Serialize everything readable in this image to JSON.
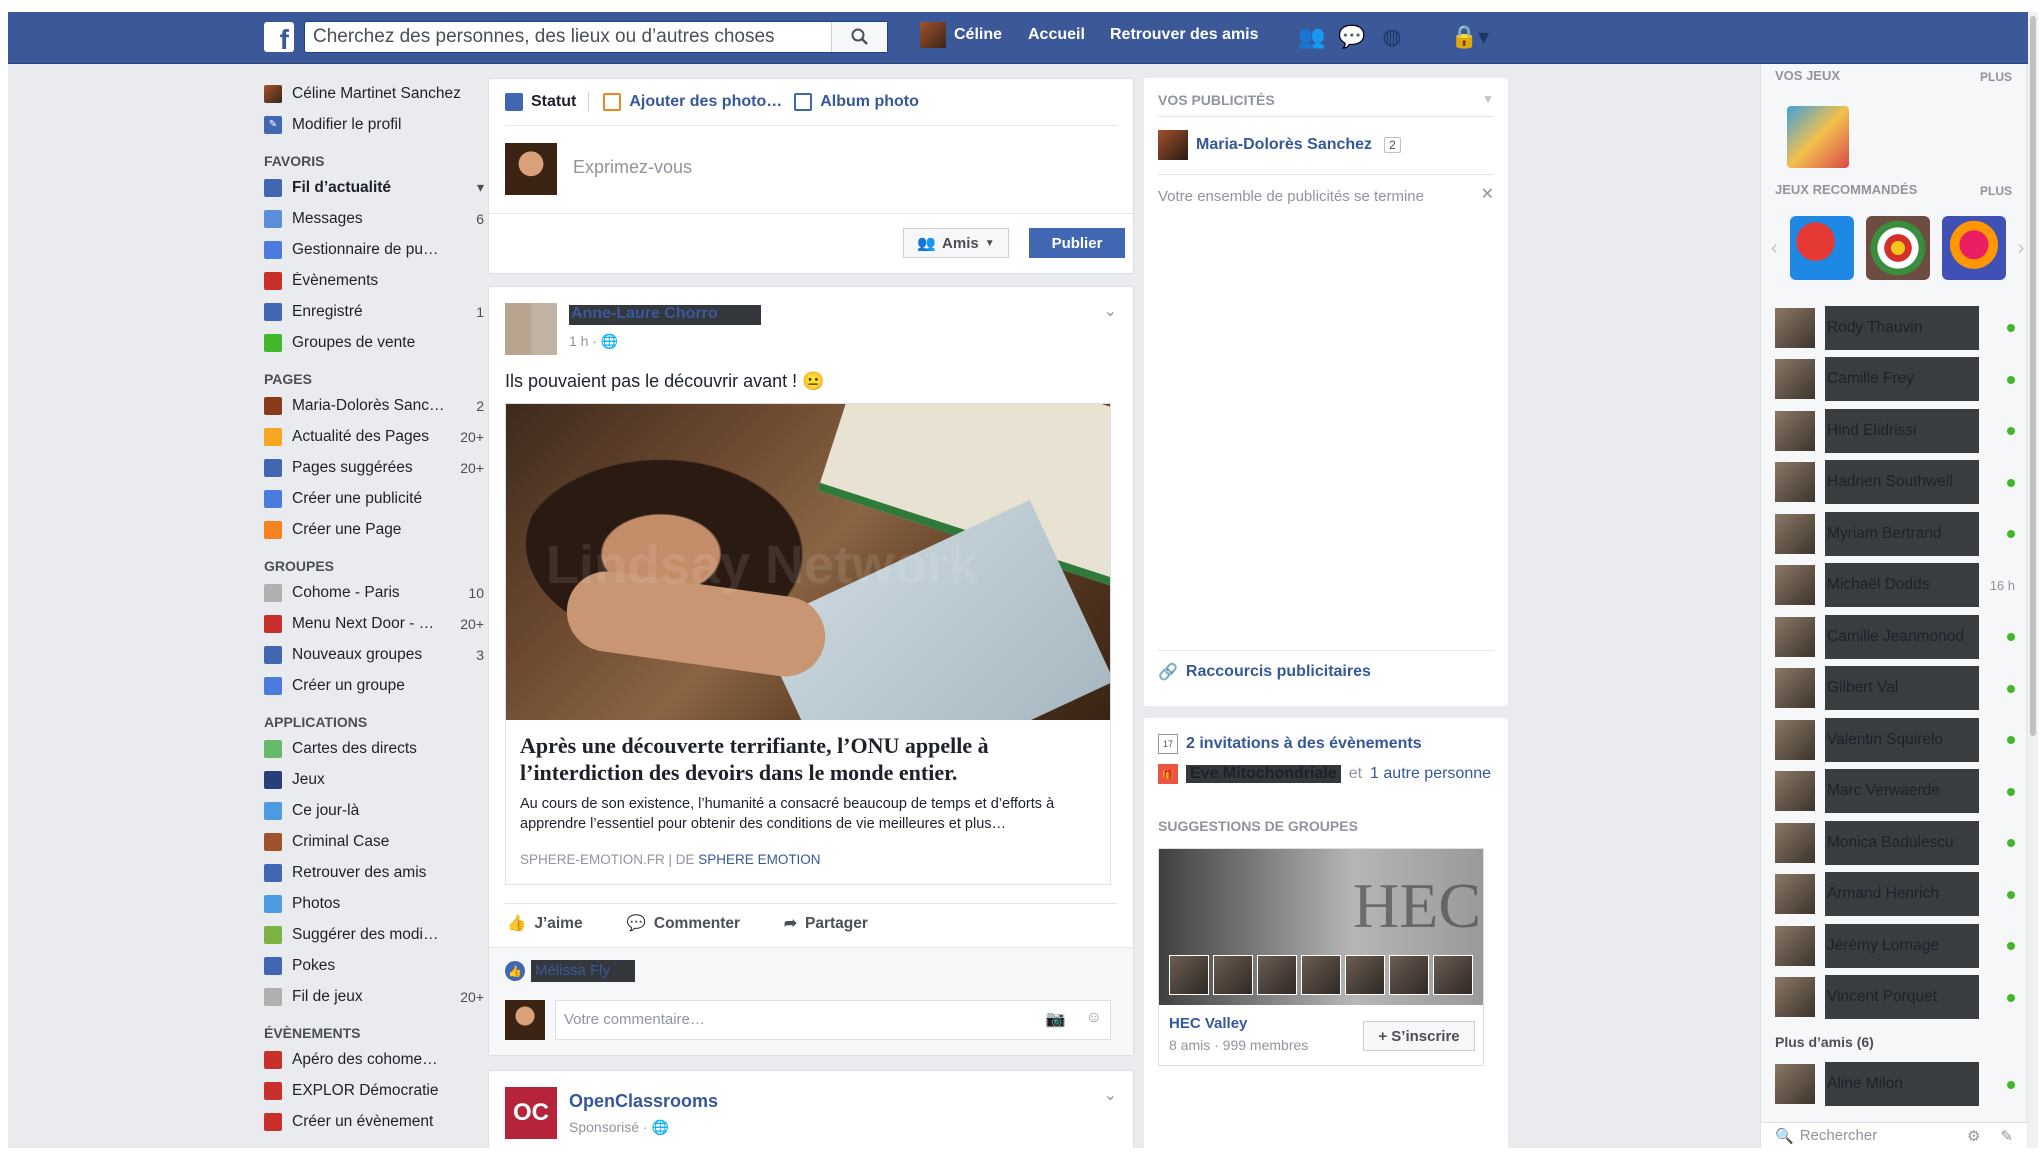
{
  "header": {
    "search_placeholder": "Cherchez des personnes, des lieux ou d’autres choses",
    "user": "Céline",
    "home": "Accueil",
    "find_friends": "Retrouver des amis"
  },
  "left": {
    "profile_name": "Céline Martinet Sanchez",
    "edit_profile": "Modifier le profil",
    "sections": [
      {
        "title": "FAVORIS",
        "items": [
          {
            "label": "Fil d’actualité",
            "count": "",
            "bold": true,
            "color": "#4267b2"
          },
          {
            "label": "Messages",
            "count": "6",
            "color": "#5b8ed6"
          },
          {
            "label": "Gestionnaire de pu…",
            "count": "",
            "color": "#4c7be0"
          },
          {
            "label": "Évènements",
            "count": "",
            "color": "#c9302c"
          },
          {
            "label": "Enregistré",
            "count": "1",
            "color": "#4267b2"
          },
          {
            "label": "Groupes de vente",
            "count": "",
            "color": "#42b72a"
          }
        ]
      },
      {
        "title": "PAGES",
        "items": [
          {
            "label": "Maria-Dolorès Sanc…",
            "count": "2",
            "color": "#8a3b1e"
          },
          {
            "label": "Actualité des Pages",
            "count": "20+",
            "color": "#f5a623"
          },
          {
            "label": "Pages suggérées",
            "count": "20+",
            "color": "#4267b2"
          },
          {
            "label": "Créer une publicité",
            "count": "",
            "color": "#4c7be0"
          },
          {
            "label": "Créer une Page",
            "count": "",
            "color": "#f58220"
          }
        ]
      },
      {
        "title": "GROUPES",
        "items": [
          {
            "label": "Cohome - Paris",
            "count": "10",
            "color": "#b0b0b0"
          },
          {
            "label": "Menu Next Door - …",
            "count": "20+",
            "color": "#c9302c"
          },
          {
            "label": "Nouveaux groupes",
            "count": "3",
            "color": "#4267b2"
          },
          {
            "label": "Créer un groupe",
            "count": "",
            "color": "#4c7be0"
          }
        ]
      },
      {
        "title": "APPLICATIONS",
        "items": [
          {
            "label": "Cartes des directs",
            "count": "",
            "color": "#66bb6a"
          },
          {
            "label": "Jeux",
            "count": "",
            "color": "#2a3f7a"
          },
          {
            "label": "Ce jour-là",
            "count": "",
            "color": "#4c9be0"
          },
          {
            "label": "Criminal Case",
            "count": "",
            "color": "#a0522d"
          },
          {
            "label": "Retrouver des amis",
            "count": "",
            "color": "#4267b2"
          },
          {
            "label": "Photos",
            "count": "",
            "color": "#4c9be0"
          },
          {
            "label": "Suggérer des modi…",
            "count": "",
            "color": "#7cb342"
          },
          {
            "label": "Pokes",
            "count": "",
            "color": "#4267b2"
          },
          {
            "label": "Fil de jeux",
            "count": "20+",
            "color": "#b0b0b0"
          }
        ]
      },
      {
        "title": "ÉVÈNEMENTS",
        "items": [
          {
            "label": "Apéro des cohome…",
            "count": "",
            "color": "#c9302c"
          },
          {
            "label": "EXPLOR Démocratie",
            "count": "",
            "color": "#c9302c"
          },
          {
            "label": "Créer un évènement",
            "count": "",
            "color": "#c9302c"
          }
        ]
      }
    ]
  },
  "composer": {
    "tab_status": "Statut",
    "tab_photos": "Ajouter des photo…",
    "tab_album": "Album photo",
    "placeholder": "Exprimez-vous",
    "audience": "Amis",
    "publish": "Publier"
  },
  "post": {
    "author": "Anne-Laure Chorro",
    "time": "1 h ·",
    "text": "Ils pouvaient pas le découvrir avant ! 😐",
    "watermark": "Lindsay Network",
    "link_title": "Après une découverte terrifiante, l’ONU appelle à l’interdiction des devoirs dans le monde entier.",
    "link_desc": "Au cours de son existence, l’humanité a consacré beaucoup de temps et d’efforts à apprendre l’essentiel pour obtenir des conditions de vie meilleures et plus…",
    "link_source": "SPHERE-EMOTION.FR | DE",
    "link_source_name": "SPHERE EMOTION",
    "like": "J’aime",
    "comment": "Commenter",
    "share": "Partager",
    "liker": "Mélissa Fly",
    "comment_placeholder": "Votre commentaire…"
  },
  "post2": {
    "author": "OpenClassrooms",
    "meta": "Sponsorisé ·"
  },
  "ads": {
    "heading": "VOS PUBLICITÉS",
    "page_name": "Maria-Dolorès Sanchez",
    "page_badge": "2",
    "ending": "Votre ensemble de publicités se termine",
    "shortcuts": "Raccourcis publicitaires"
  },
  "events": {
    "invitations": "2 invitations à des évènements",
    "person": "Eve Mitochondriale",
    "and": "et",
    "other": "1 autre personne",
    "groups_heading": "SUGGESTIONS DE GROUPES",
    "group_name": "HEC Valley",
    "group_meta": "8 amis · 999 membres",
    "join": "+ S’inscrire"
  },
  "chat": {
    "my_games": "VOS JEUX",
    "more": "PLUS",
    "recommended": "JEUX RECOMMANDÉS",
    "contacts": [
      {
        "name": "Rody Thauvin",
        "status": "online"
      },
      {
        "name": "Camille Frey",
        "status": "online"
      },
      {
        "name": "Hind Elidrissi",
        "status": "online"
      },
      {
        "name": "Hadrien Southwell",
        "status": "online"
      },
      {
        "name": "Myriam Bertrand",
        "status": "online"
      },
      {
        "name": "Michaël Dodds",
        "status": "16 h"
      },
      {
        "name": "Camille Jeanmonod",
        "status": "online"
      },
      {
        "name": "Gilbert Val",
        "status": "online"
      },
      {
        "name": "Valentin Squirelo",
        "status": "online"
      },
      {
        "name": "Marc Verwaerde",
        "status": "online"
      },
      {
        "name": "Monica Badulescu",
        "status": "online"
      },
      {
        "name": "Armand Henrich",
        "status": "online"
      },
      {
        "name": "Jérémy Lornage",
        "status": "online"
      },
      {
        "name": "Vincent Porquet",
        "status": "online"
      }
    ],
    "more_friends": "Plus d’amis (6)",
    "last_contact": "Aline Milon",
    "search": "Rechercher"
  }
}
